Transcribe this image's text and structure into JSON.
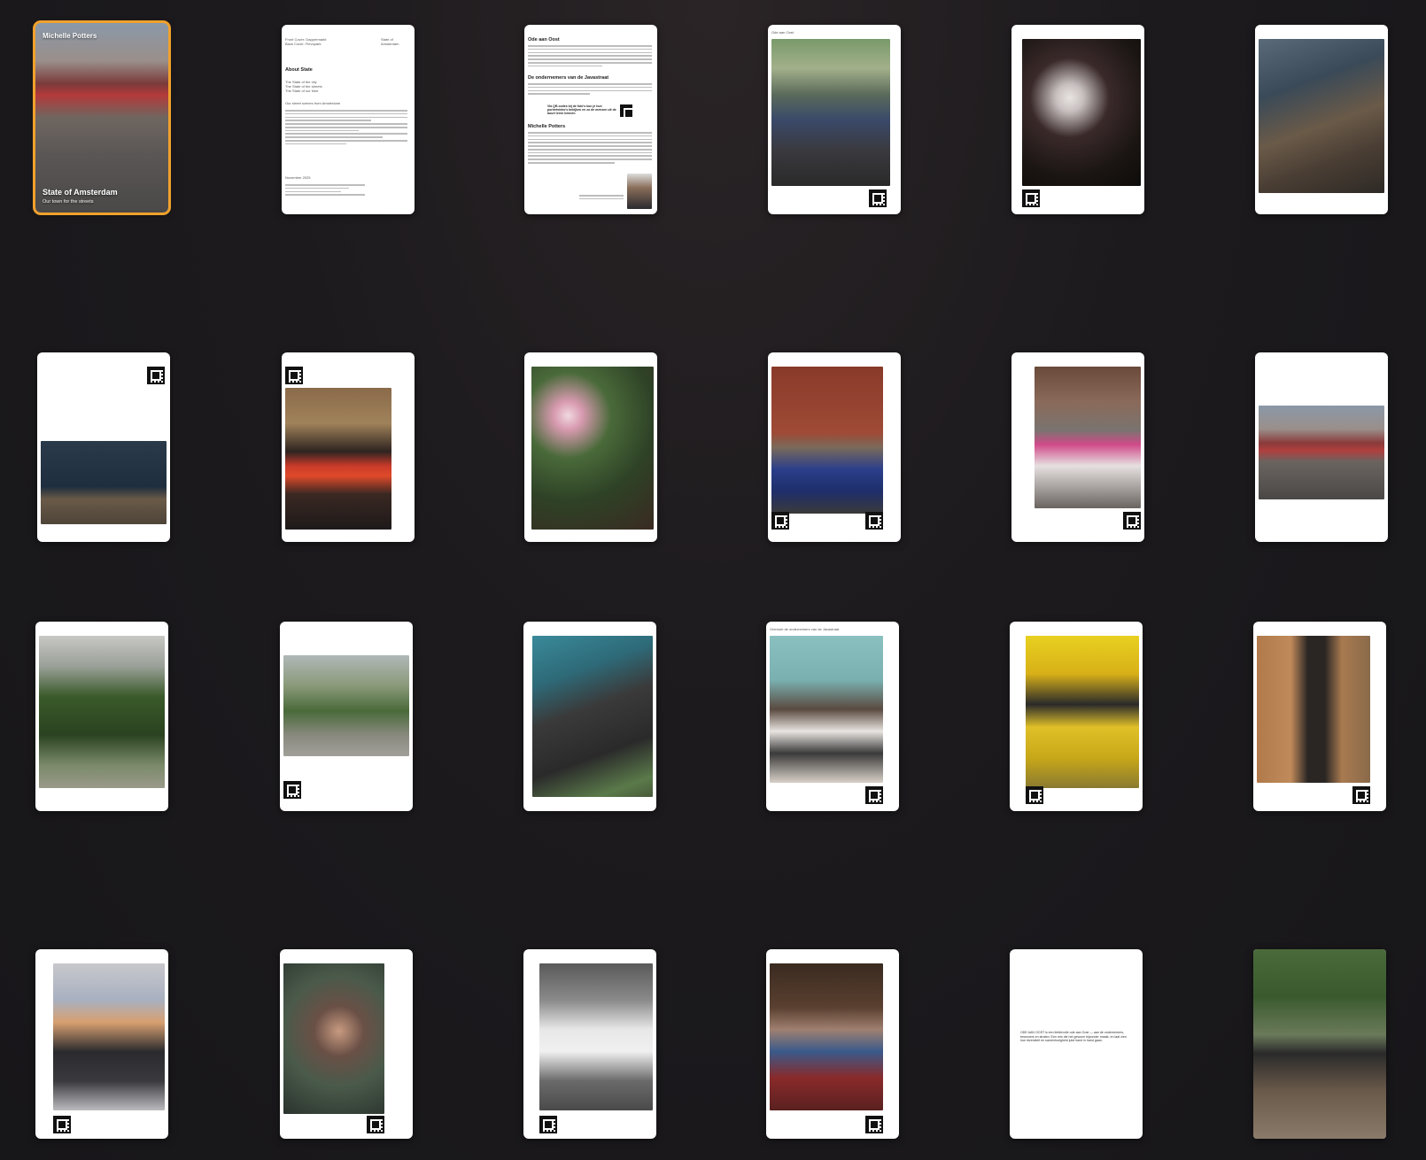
{
  "cover": {
    "author": "Michelle Potters",
    "title": "State of Amsterdam",
    "subtitle": "Our town for the streets"
  },
  "about": {
    "meta_left": "Front Cover: Dappermarkt\nBack Cover: Flevopark",
    "meta_right": "State of\nAmsterdam",
    "heading": "About State",
    "sub1": "The State of the city\nThe State of the streets\nThe State of our time",
    "sub2": "Our street scenes from Amsterdam",
    "date": "November 2025"
  },
  "ode": {
    "heading1": "Ode aan Oost",
    "heading2": "De ondernemers van de Javastraat",
    "qr_note": "Via QR-codes bij de foto's kun je hun portretvideo's bekijken en zo de mensen uit de buurt leren kennen",
    "heading3": "Michelle Potters"
  },
  "pages": {
    "p4_header": "Ode aan Oost",
    "p16_header": "Ontmoet de ondernemers van de Javastraat",
    "p23_text": "ODE AAN OOST is een liefdevolle ode aan Oost — aan de ondernemers, bewoners en straten. Een reis die het gewone bijzonder maakt, en laat zien hoe diversiteit en samenhorigheid juist hand in hand gaan."
  },
  "icons": {
    "qr": "qr-code-icon"
  },
  "colors": {
    "selection": "#f0a12c",
    "background": "#1c1a1d"
  }
}
